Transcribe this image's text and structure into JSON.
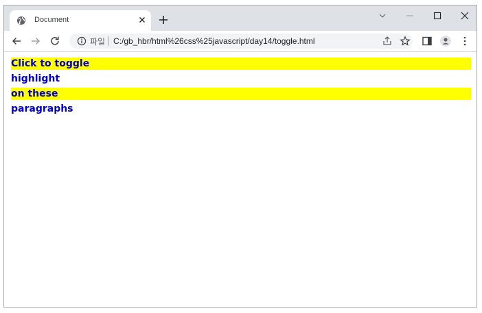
{
  "browser": {
    "tab": {
      "title": "Document"
    },
    "address": {
      "scheme_label": "파일",
      "url": "C:/gb_hbr/html%26css%25javascript/day14/toggle.html"
    }
  },
  "page": {
    "paragraphs": [
      {
        "text": "Click to toggle",
        "highlighted": true
      },
      {
        "text": "highlight",
        "highlighted": false
      },
      {
        "text": "on these",
        "highlighted": true
      },
      {
        "text": "paragraphs",
        "highlighted": false
      }
    ],
    "highlight_color": "#ffff00",
    "text_color": "#0000d6"
  },
  "icons": [
    "globe-icon",
    "close-icon",
    "plus-icon",
    "chevron-down-icon",
    "minimize-icon",
    "maximize-icon",
    "window-close-icon",
    "back-icon",
    "forward-icon",
    "reload-icon",
    "info-icon",
    "share-icon",
    "star-icon",
    "sidepanel-icon",
    "profile-icon",
    "menu-icon"
  ]
}
